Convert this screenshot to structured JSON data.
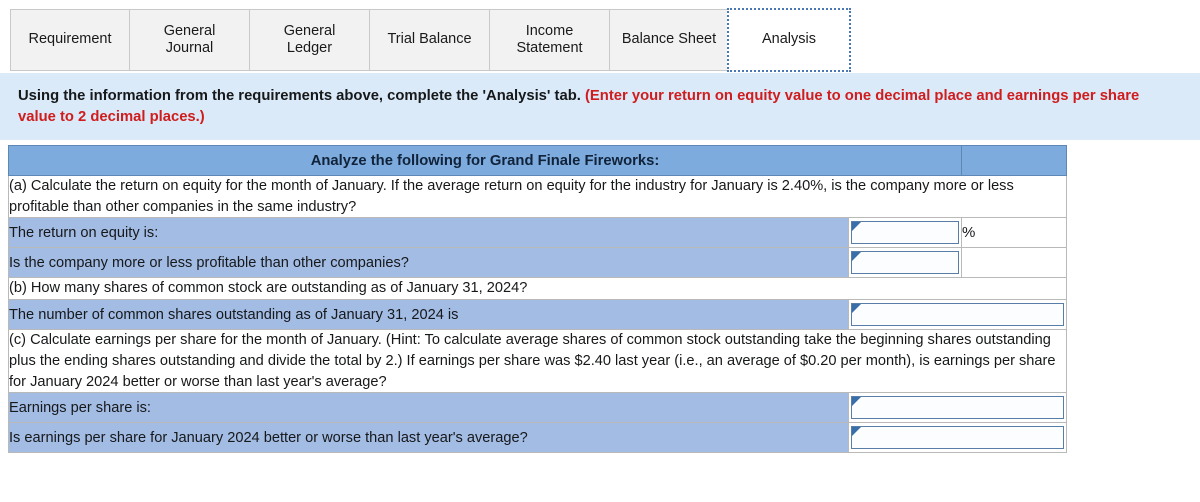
{
  "tabs": [
    {
      "label": "Requirement",
      "active": false
    },
    {
      "label": "General\nJournal",
      "active": false
    },
    {
      "label": "General\nLedger",
      "active": false
    },
    {
      "label": "Trial Balance",
      "active": false
    },
    {
      "label": "Income\nStatement",
      "active": false
    },
    {
      "label": "Balance Sheet",
      "active": false
    },
    {
      "label": "Analysis",
      "active": true
    }
  ],
  "banner": {
    "main": "Using the information from the requirements above, complete the 'Analysis' tab.",
    "red": "(Enter your return on equity value to one decimal place and earnings per share value to 2 decimal places.)"
  },
  "table": {
    "header": "Analyze the following for Grand Finale Fireworks:",
    "question_a": "(a) Calculate the return on equity for the month of January. If the average return on equity for the industry for January is 2.40%, is the company more or less profitable than other companies in the same industry?",
    "row_a1_label": "The return on equity is:",
    "row_a1_value": "",
    "row_a1_unit": "%",
    "row_a2_label": "Is the company more or less profitable than other companies?",
    "row_a2_value": "",
    "question_b": "(b) How many shares of common stock are outstanding as of January 31, 2024?",
    "row_b1_label": "The number of common shares outstanding as of January 31, 2024 is",
    "row_b1_value": "",
    "question_c": "(c) Calculate earnings per share for the month of January. (Hint: To calculate average shares of common stock outstanding take the beginning shares outstanding plus the ending shares outstanding and divide the total by 2.) If earnings per share was $2.40 last year (i.e., an average of $0.20  per month), is earnings per share for January 2024 better or worse than last year's average?",
    "row_c1_label": "Earnings per share is:",
    "row_c1_value": "",
    "row_c2_label": "Is earnings per share for January 2024 better or worse than last year's average?",
    "row_c2_value": ""
  },
  "colors": {
    "header_blue": "#7dabdd",
    "label_blue": "#a3bce4",
    "banner_blue": "#daeaf8",
    "red_text": "#d01c1c",
    "tab_gray": "#f2f2f2",
    "focus_blue": "#4a78b5"
  }
}
